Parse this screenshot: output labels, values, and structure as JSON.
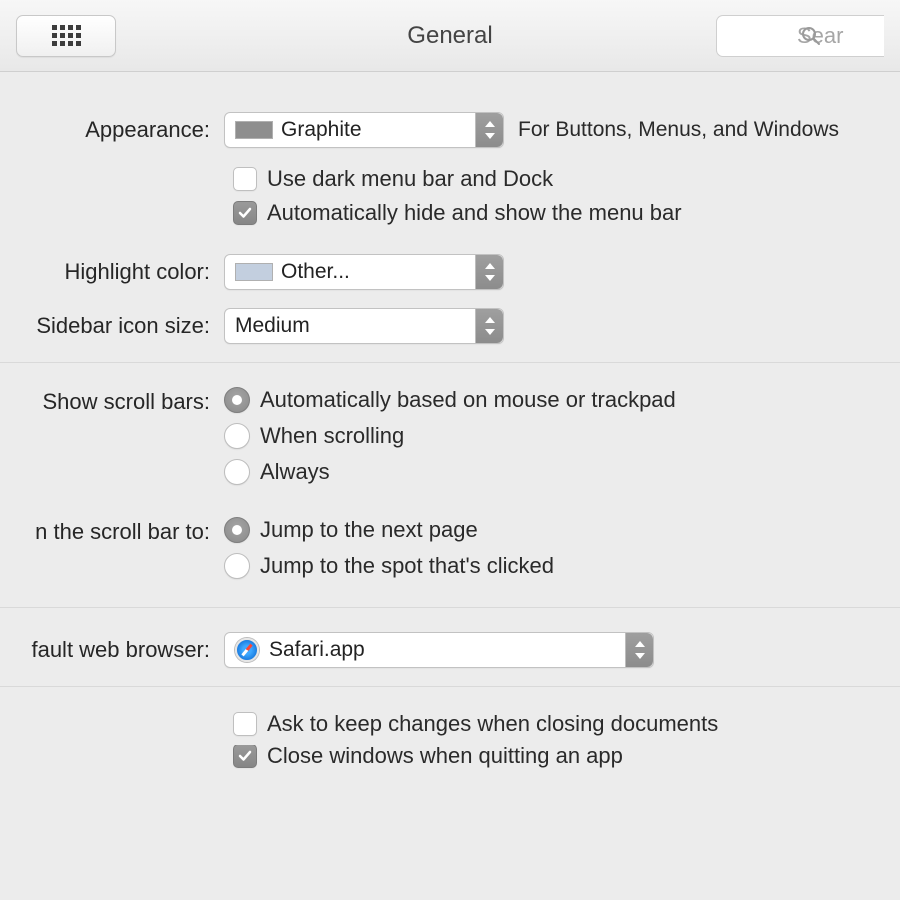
{
  "toolbar": {
    "title": "General",
    "search_placeholder": "Sear"
  },
  "appearance": {
    "label": "Appearance:",
    "value": "Graphite",
    "note": "For Buttons, Menus, and Windows",
    "dark_menu_label": "Use dark menu bar and Dock",
    "auto_hide_label": "Automatically hide and show the menu bar",
    "dark_menu_checked": false,
    "auto_hide_checked": true
  },
  "highlight": {
    "label": "Highlight color:",
    "value": "Other..."
  },
  "sidebar": {
    "label": "Sidebar icon size:",
    "value": "Medium"
  },
  "scrollbars": {
    "label": "Show scroll bars:",
    "options": [
      "Automatically based on mouse or trackpad",
      "When scrolling",
      "Always"
    ],
    "selected_index": 0
  },
  "click_scroll": {
    "label": "n the scroll bar to:",
    "options": [
      "Jump to the next page",
      "Jump to the spot that's clicked"
    ],
    "selected_index": 0
  },
  "browser": {
    "label": "fault web browser:",
    "value": "Safari.app"
  },
  "documents": {
    "ask_label": "Ask to keep changes when closing documents",
    "ask_checked": false,
    "close_label": "Close windows when quitting an app",
    "close_checked": true
  }
}
